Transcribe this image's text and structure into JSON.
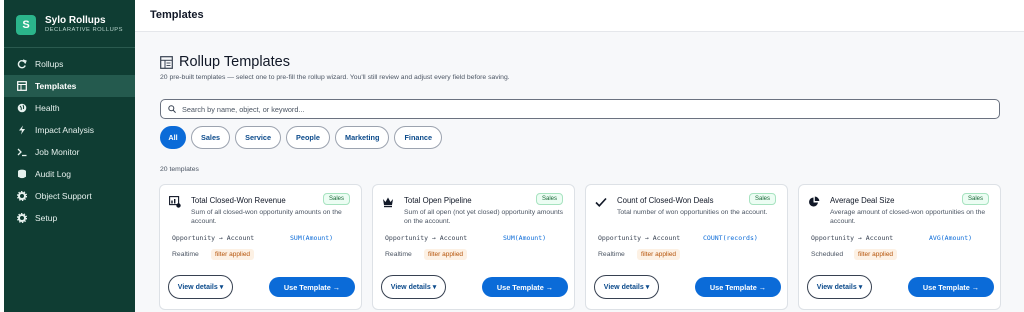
{
  "app": {
    "name": "Sylo Rollups",
    "tagline": "DECLARATIVE ROLLUPS",
    "logo_letter": "S"
  },
  "sidebar": {
    "items": [
      {
        "label": "Rollups",
        "icon": "rollup-arrow-icon",
        "active": false
      },
      {
        "label": "Templates",
        "icon": "template-grid-icon",
        "active": true
      },
      {
        "label": "Health",
        "icon": "health-globe-icon",
        "active": false
      },
      {
        "label": "Impact Analysis",
        "icon": "lightning-icon",
        "active": false
      },
      {
        "label": "Job Monitor",
        "icon": "terminal-prompt-icon",
        "active": false
      },
      {
        "label": "Audit Log",
        "icon": "database-icon",
        "active": false
      },
      {
        "label": "Object Support",
        "icon": "gear-icon",
        "active": false
      },
      {
        "label": "Setup",
        "icon": "gear-icon",
        "active": false
      }
    ]
  },
  "topbar": {
    "title": "Templates"
  },
  "main": {
    "title": "Rollup Templates",
    "subtitle": "20 pre-built templates — select one to pre-fill the rollup wizard. You'll still review and adjust every field before saving.",
    "search_placeholder": "Search by name, object, or keyword...",
    "filters": [
      "All",
      "Sales",
      "Service",
      "People",
      "Marketing",
      "Finance"
    ],
    "active_filter": "All",
    "count_label": "20 templates"
  },
  "cards": [
    {
      "title": "Total Closed-Won Revenue",
      "badge": "Sales",
      "description": "Sum of all closed-won opportunity amounts on the account.",
      "mapping": "Opportunity → Account",
      "aggregate": "SUM(Amount)",
      "schedule": "Realtime",
      "filter": "filter applied",
      "icon": "revenue-chart-icon",
      "details_label": "View details ▾",
      "use_label": "Use Template →"
    },
    {
      "title": "Total Open Pipeline",
      "badge": "Sales",
      "description": "Sum of all open (not yet closed) opportunity amounts on the account.",
      "mapping": "Opportunity → Account",
      "aggregate": "SUM(Amount)",
      "schedule": "Realtime",
      "filter": "filter applied",
      "icon": "crown-icon",
      "details_label": "View details ▾",
      "use_label": "Use Template →"
    },
    {
      "title": "Count of Closed-Won Deals",
      "badge": "Sales",
      "description": "Total number of won opportunities on the account.",
      "mapping": "Opportunity → Account",
      "aggregate": "COUNT(records)",
      "schedule": "Realtime",
      "filter": "filter applied",
      "icon": "checkmark-icon",
      "details_label": "View details ▾",
      "use_label": "Use Template →"
    },
    {
      "title": "Average Deal Size",
      "badge": "Sales",
      "description": "Average amount of closed-won opportunities on the account.",
      "mapping": "Opportunity → Account",
      "aggregate": "AVG(Amount)",
      "schedule": "Scheduled",
      "filter": "filter applied",
      "icon": "pie-chart-icon",
      "details_label": "View details ▾",
      "use_label": "Use Template →"
    }
  ],
  "colors": {
    "sidebar_bg": "#0f3d33",
    "accent": "#0b6bd8",
    "badge_green": "#166534",
    "filter_orange": "#b45309"
  }
}
